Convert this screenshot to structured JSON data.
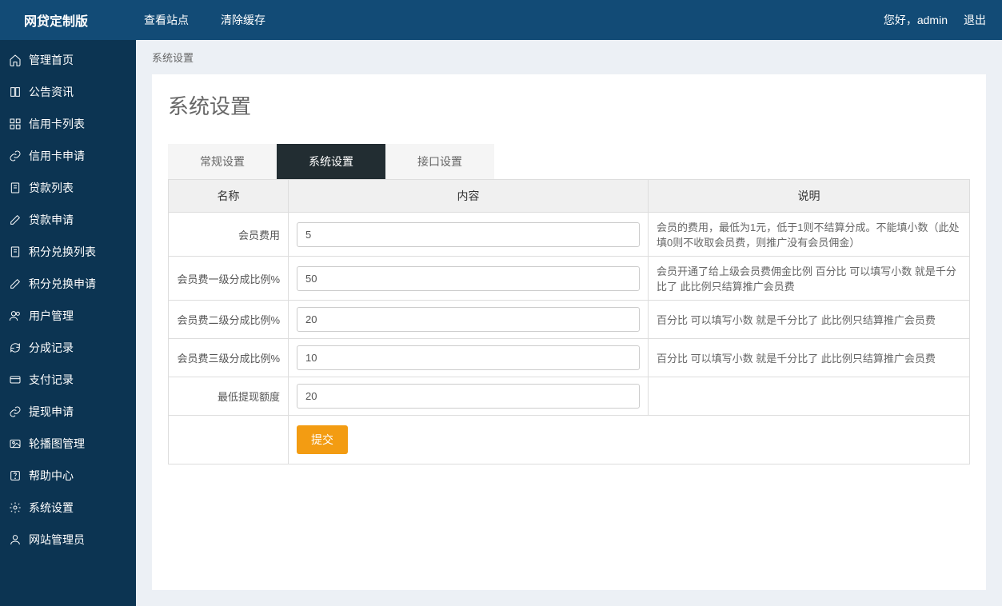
{
  "header": {
    "brand": "网贷定制版",
    "nav": [
      {
        "label": "查看站点"
      },
      {
        "label": "清除缓存"
      }
    ],
    "greeting": "您好，admin",
    "logout": "退出"
  },
  "sidebar": {
    "items": [
      {
        "label": "管理首页",
        "icon": "home"
      },
      {
        "label": "公告资讯",
        "icon": "book"
      },
      {
        "label": "信用卡列表",
        "icon": "grid"
      },
      {
        "label": "信用卡申请",
        "icon": "link"
      },
      {
        "label": "贷款列表",
        "icon": "file"
      },
      {
        "label": "贷款申请",
        "icon": "edit"
      },
      {
        "label": "积分兑换列表",
        "icon": "file"
      },
      {
        "label": "积分兑换申请",
        "icon": "edit"
      },
      {
        "label": "用户管理",
        "icon": "users"
      },
      {
        "label": "分成记录",
        "icon": "refresh"
      },
      {
        "label": "支付记录",
        "icon": "card"
      },
      {
        "label": "提现申请",
        "icon": "link"
      },
      {
        "label": "轮播图管理",
        "icon": "image"
      },
      {
        "label": "帮助中心",
        "icon": "help"
      },
      {
        "label": "系统设置",
        "icon": "gear"
      },
      {
        "label": "网站管理员",
        "icon": "user"
      }
    ]
  },
  "breadcrumb": "系统设置",
  "page_title": "系统设置",
  "tabs": [
    {
      "label": "常规设置",
      "active": false
    },
    {
      "label": "系统设置",
      "active": true
    },
    {
      "label": "接口设置",
      "active": false
    }
  ],
  "table": {
    "headers": {
      "name": "名称",
      "content": "内容",
      "desc": "说明"
    },
    "rows": [
      {
        "label": "会员费用",
        "value": "5",
        "desc": "会员的费用，最低为1元，低于1则不结算分成。不能填小数（此处填0则不收取会员费，则推广没有会员佣金）"
      },
      {
        "label": "会员费一级分成比例%",
        "value": "50",
        "desc": "会员开通了给上级会员费佣金比例 百分比 可以填写小数 就是千分比了 此比例只结算推广会员费"
      },
      {
        "label": "会员费二级分成比例%",
        "value": "20",
        "desc": "百分比 可以填写小数 就是千分比了 此比例只结算推广会员费"
      },
      {
        "label": "会员费三级分成比例%",
        "value": "10",
        "desc": "百分比 可以填写小数 就是千分比了 此比例只结算推广会员费"
      },
      {
        "label": "最低提现额度",
        "value": "20",
        "desc": ""
      }
    ],
    "submit": "提交"
  }
}
